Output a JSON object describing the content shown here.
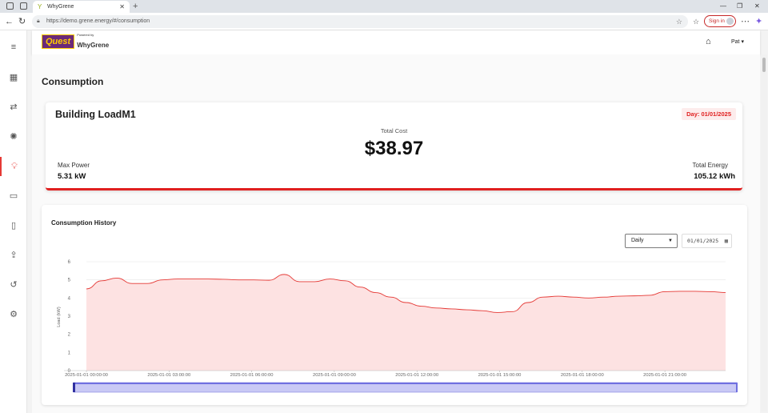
{
  "browser": {
    "tab_title": "WhyGrene",
    "url": "https://demo.grene.energy/#/consumption",
    "signin_label": "Sign in"
  },
  "header": {
    "logo_text": "Quest",
    "powered_by": "Powered by",
    "brand": "WhyGrene",
    "user_name": "Pat"
  },
  "page": {
    "title": "Consumption"
  },
  "summary": {
    "building_name": "Building LoadM1",
    "day_badge": "Day: 01/01/2025",
    "total_cost_label": "Total Cost",
    "total_cost_value": "$38.97",
    "max_power_label": "Max Power",
    "max_power_value": "5.31 kW",
    "total_energy_label": "Total Energy",
    "total_energy_value": "105.12 kWh"
  },
  "history": {
    "title": "Consumption History",
    "period_selected": "Daily",
    "date_value": "01/01/2025"
  },
  "chart_data": {
    "type": "area",
    "ylabel": "Load (kW)",
    "ylim": [
      0,
      6
    ],
    "yticks": [
      "0",
      "1",
      "2",
      "3",
      "4",
      "5",
      "6"
    ],
    "xticks": [
      "2025-01-01 00:00:00",
      "2025-01-01 03:00:00",
      "2025-01-01 06:00:00",
      "2025-01-01 09:00:00",
      "2025-01-01 12:00:00",
      "2025-01-01 15:00:00",
      "2025-01-01 18:00:00",
      "2025-01-01 21:00:00"
    ],
    "x_hours": [
      0,
      0.5,
      1,
      1.5,
      2,
      2.5,
      3,
      3.5,
      4,
      4.5,
      5,
      5.5,
      6,
      6.5,
      7,
      7.5,
      8,
      8.5,
      9,
      9.5,
      10,
      10.5,
      11,
      11.5,
      12,
      12.5,
      13,
      13.5,
      14,
      14.5,
      15,
      15.5,
      16,
      16.5,
      17,
      17.5,
      18,
      18.5,
      19,
      19.5,
      20,
      20.5,
      21,
      21.5,
      22,
      22.5,
      23
    ],
    "values": [
      4.5,
      4.95,
      5.1,
      4.8,
      4.8,
      5.0,
      5.05,
      5.05,
      5.05,
      5.03,
      5.0,
      5.0,
      4.98,
      5.3,
      4.9,
      4.9,
      5.05,
      4.95,
      4.6,
      4.3,
      4.05,
      3.75,
      3.55,
      3.45,
      3.4,
      3.35,
      3.3,
      3.2,
      3.25,
      3.75,
      4.05,
      4.1,
      4.05,
      4.0,
      4.05,
      4.1,
      4.12,
      4.15,
      4.35,
      4.37,
      4.37,
      4.35,
      4.3
    ],
    "line_color": "#e53935",
    "fill_color": "#fde2e2",
    "grid": true
  }
}
